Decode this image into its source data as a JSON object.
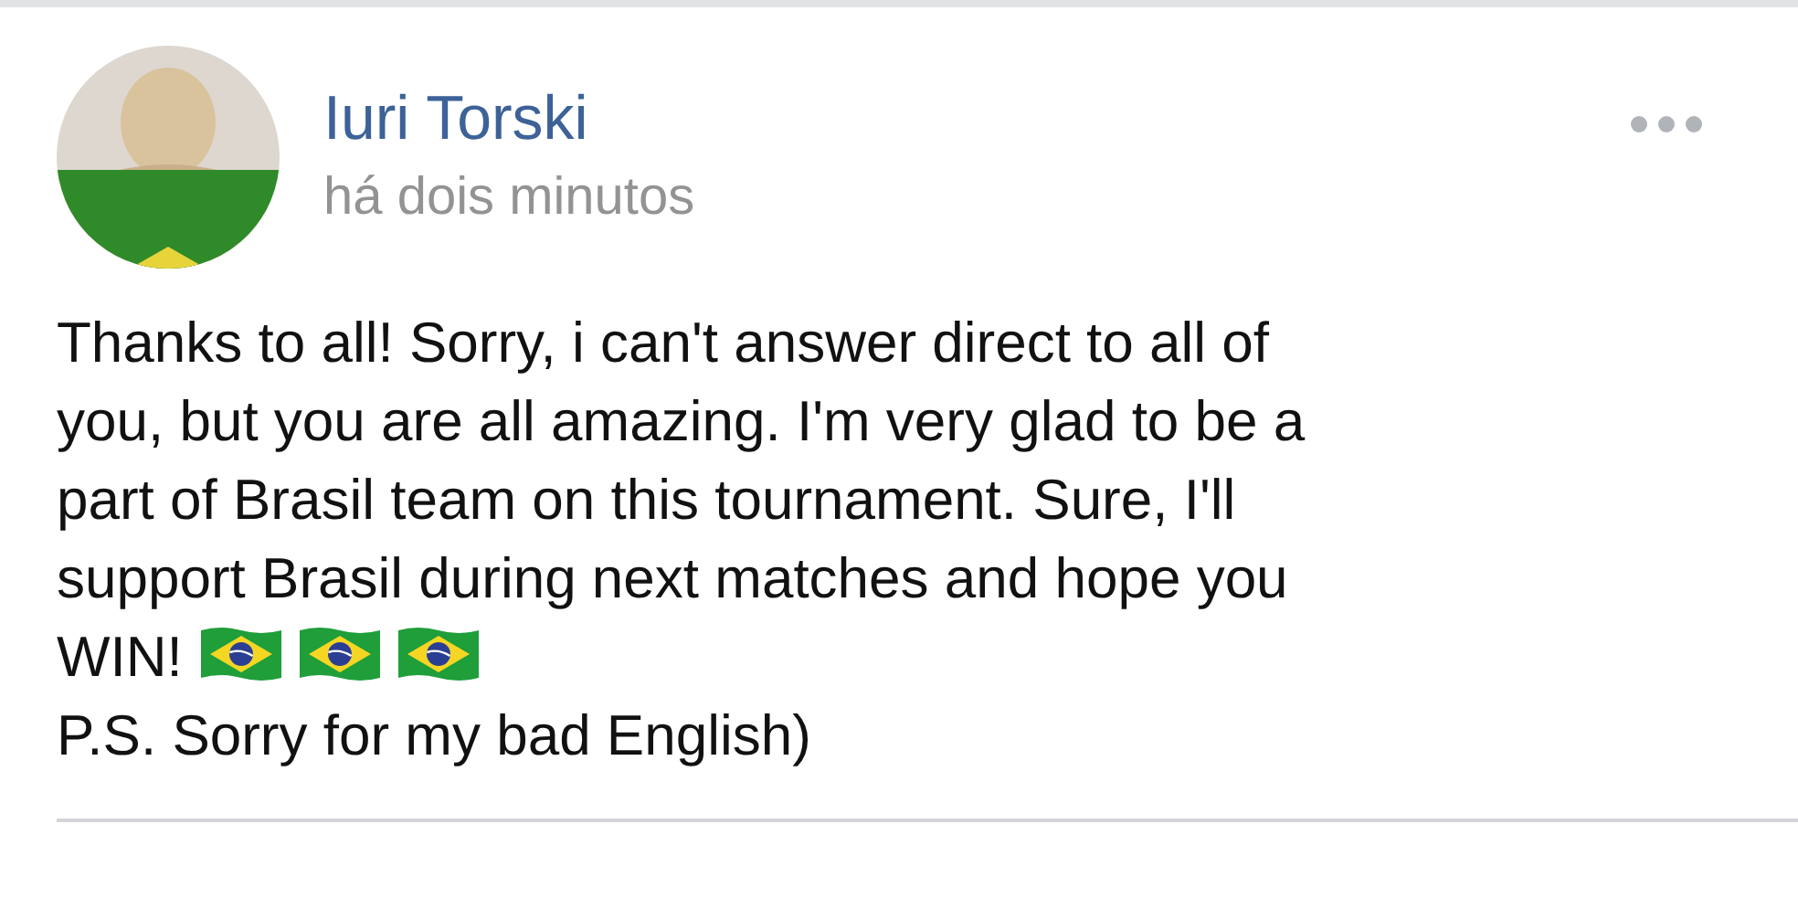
{
  "post": {
    "author": "Iuri Torski",
    "time": "há dois minutos",
    "lines": [
      {
        "text": "Thanks to all! Sorry, i can't answer direct to all of",
        "kind": "text"
      },
      {
        "text": "you, but you are all amazing. I'm very glad to be a",
        "kind": "text"
      },
      {
        "text": "part of Brasil team on this tournament. Sure, I'll",
        "kind": "text"
      },
      {
        "text": "support Brasil during next matches and hope you",
        "kind": "text"
      },
      {
        "text": "WIN!",
        "kind": "flags"
      },
      {
        "text": "P.S. Sorry for my bad English)",
        "kind": "text"
      }
    ]
  }
}
